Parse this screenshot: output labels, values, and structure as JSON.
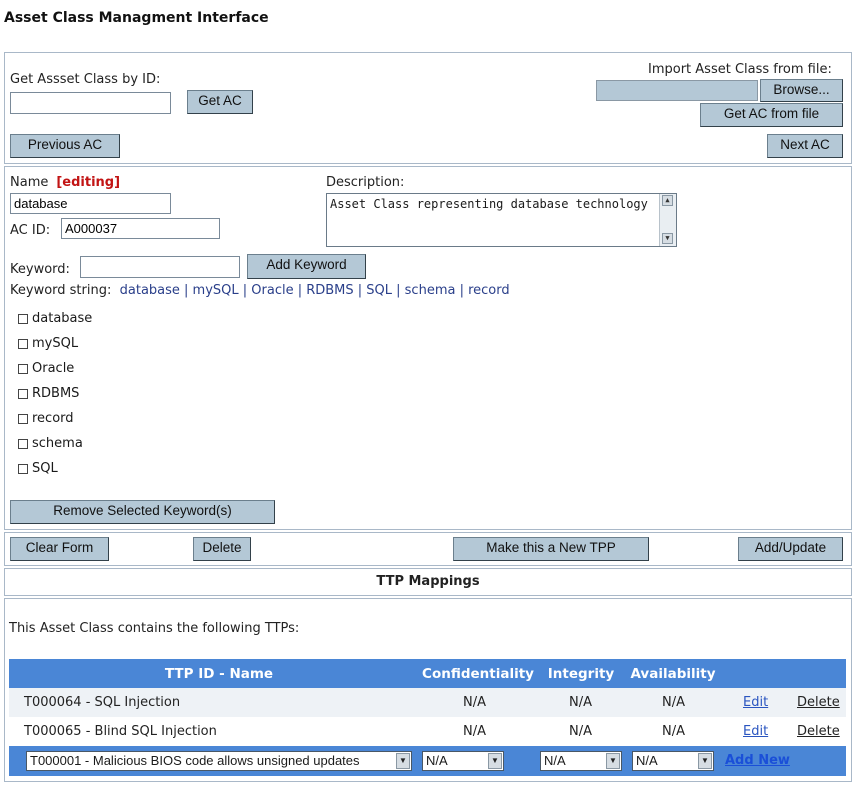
{
  "page_title": "Asset Class Managment Interface",
  "get_by_id": {
    "label": "Get Assset Class by ID:",
    "value": "",
    "button": "Get AC"
  },
  "import": {
    "label": "Import Asset Class from file:",
    "file_value": "",
    "browse": "Browse...",
    "get_from_file": "Get AC from file"
  },
  "nav": {
    "previous": "Previous AC",
    "next": "Next AC"
  },
  "form": {
    "name_label": "Name",
    "editing_badge": "[editing]",
    "name_value": "database",
    "acid_label": "AC ID:",
    "acid_value": "A000037",
    "description_label": "Description:",
    "description_value": "Asset Class representing database technology",
    "keyword_label": "Keyword:",
    "keyword_value": "",
    "add_keyword": "Add Keyword",
    "keyword_string_label": "Keyword string:",
    "keyword_string": "database | mySQL | Oracle | RDBMS | SQL | schema | record",
    "keywords": [
      "database",
      "mySQL",
      "Oracle",
      "RDBMS",
      "record",
      "schema",
      "SQL"
    ],
    "remove_selected": "Remove Selected Keyword(s)"
  },
  "actions": {
    "clear": "Clear Form",
    "delete": "Delete",
    "make_tpp": "Make this a New TPP",
    "add_update": "Add/Update"
  },
  "ttp": {
    "section_title": "TTP Mappings",
    "intro": "This Asset Class contains the following TTPs:",
    "headers": {
      "id_name": "TTP ID - Name",
      "confidentiality": "Confidentiality",
      "integrity": "Integrity",
      "availability": "Availability"
    },
    "rows": [
      {
        "id_name": "T000064 - SQL Injection",
        "confidentiality": "N/A",
        "integrity": "N/A",
        "availability": "N/A",
        "edit": "Edit",
        "delete": "Delete"
      },
      {
        "id_name": "T000065 - Blind SQL Injection",
        "confidentiality": "N/A",
        "integrity": "N/A",
        "availability": "N/A",
        "edit": "Edit",
        "delete": "Delete"
      }
    ],
    "new_row": {
      "ttp_select": "T000001 - Malicious BIOS code allows unsigned updates",
      "confidentiality": "N/A",
      "integrity": "N/A",
      "availability": "N/A",
      "add_new": "Add New"
    }
  },
  "colors": {
    "header_blue": "#4a86d6",
    "button_bg": "#b4c8d6",
    "panel_border": "#a9b8c8",
    "editing_red": "#c21414"
  }
}
